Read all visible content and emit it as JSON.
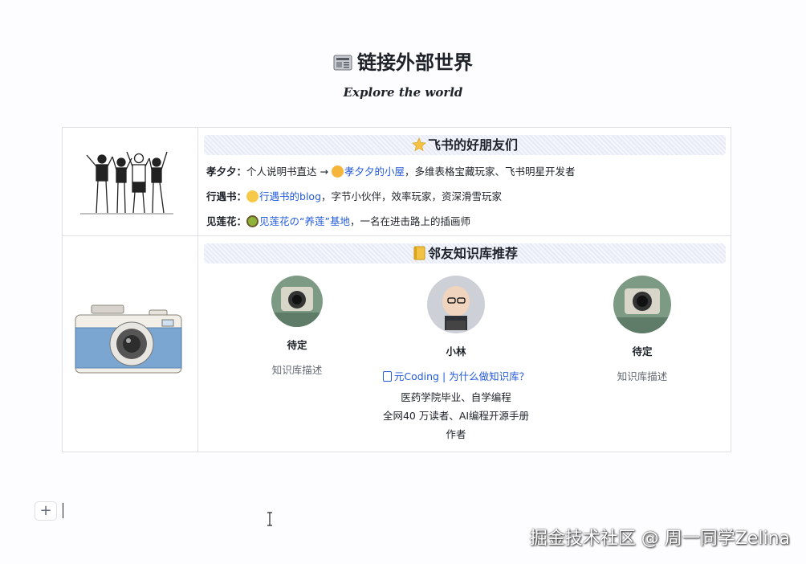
{
  "page": {
    "title": "链接外部世界",
    "title_icon": "newspaper-icon",
    "subtitle": "Explore the world"
  },
  "friends": {
    "heading": "飞书的好朋友们",
    "heading_icon": "star-icon",
    "illustration": "people-group-illustration",
    "rows": [
      {
        "name": "孝夕夕：",
        "prefix": "个人说明书直达 → ",
        "link": "孝夕夕的小屋",
        "rest": "，多维表格宝藏玩家、飞书明星开发者",
        "emoji": "hugging-face-icon"
      },
      {
        "name": "行遇书：",
        "prefix": "",
        "link": "行遇书的blog",
        "rest": "，字节小伙伴，效率玩家，资深滑雪玩家",
        "emoji": "smiling-face-icon"
      },
      {
        "name": "见莲花：",
        "prefix": "",
        "link": "见莲花の“养莲”基地",
        "rest": "，一名在进击路上的插画师",
        "emoji": "kiwi-icon"
      }
    ]
  },
  "kb": {
    "heading": "邻友知识库推荐",
    "heading_icon": "notebook-icon",
    "illustration": "camera-illustration",
    "cards": [
      {
        "name": "待定",
        "desc": "知识库描述"
      },
      {
        "name": "小林",
        "link": "元Coding | 为什么做知识库？",
        "desc_lines": [
          "医药学院毕业、自学编程",
          "全网40 万读者、AI编程开源手册",
          "作者"
        ]
      },
      {
        "name": "待定",
        "desc": "知识库描述"
      }
    ]
  },
  "editor": {
    "add_symbol": "+"
  },
  "watermark": "掘金技术社区 @ 周一同学Zelina",
  "colors": {
    "link": "#245bdb",
    "border": "#dee0e3",
    "muted": "#646a73"
  }
}
